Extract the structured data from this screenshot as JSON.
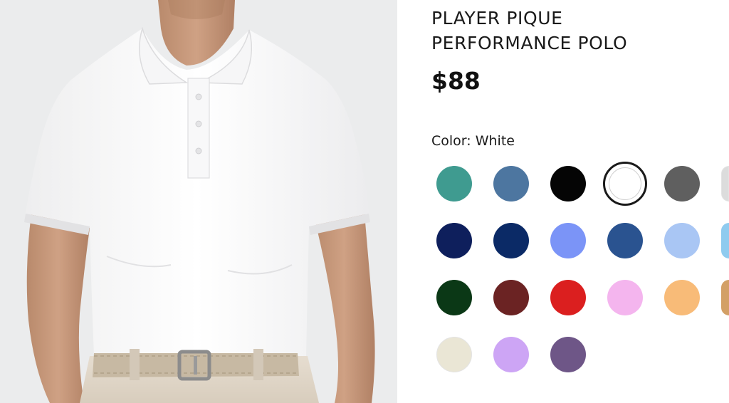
{
  "product": {
    "title_line1": "PLAYER PIQUE",
    "title_line2": "PERFORMANCE POLO",
    "price": "$88",
    "color_label": "Color: White"
  },
  "swatches": [
    {
      "name": "teal",
      "color": "#3f9b90"
    },
    {
      "name": "steel-blue",
      "color": "#4d76a0"
    },
    {
      "name": "black",
      "color": "#050505"
    },
    {
      "name": "white",
      "color": "#ffffff",
      "selected": true
    },
    {
      "name": "charcoal",
      "color": "#5f5f5f"
    },
    {
      "name": "light-gray",
      "color": "#dcdcdc"
    },
    {
      "name": "navy",
      "color": "#0e1f5c"
    },
    {
      "name": "dark-navy",
      "color": "#0b2a66"
    },
    {
      "name": "periwinkle",
      "color": "#7b94f7"
    },
    {
      "name": "royal-blue",
      "color": "#2a5390"
    },
    {
      "name": "light-blue",
      "color": "#a9c6f4"
    },
    {
      "name": "sky-blue",
      "color": "#8fcbef"
    },
    {
      "name": "forest-green",
      "color": "#0b3816"
    },
    {
      "name": "maroon",
      "color": "#6b2323"
    },
    {
      "name": "red",
      "color": "#db1f1f"
    },
    {
      "name": "pink",
      "color": "#f4b5ee"
    },
    {
      "name": "peach",
      "color": "#f8bb78"
    },
    {
      "name": "tan",
      "color": "#d3a066"
    },
    {
      "name": "cream",
      "color": "#eae6d5"
    },
    {
      "name": "lavender",
      "color": "#cda5f5"
    },
    {
      "name": "purple",
      "color": "#6e5687"
    }
  ]
}
